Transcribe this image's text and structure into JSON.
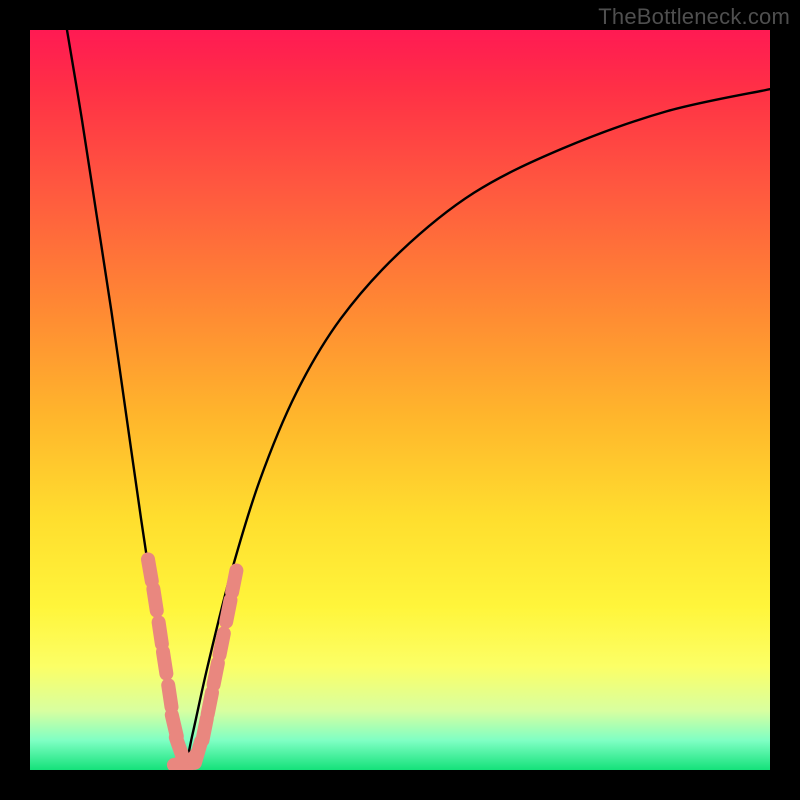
{
  "watermark": "TheBottleneck.com",
  "colors": {
    "frame": "#000000",
    "curve": "#000000",
    "marker": "#e9877f",
    "gradient_top": "#ff1a53",
    "gradient_bottom": "#14e27a"
  },
  "chart_data": {
    "type": "line",
    "title": "",
    "xlabel": "",
    "ylabel": "",
    "xlim": [
      0,
      100
    ],
    "ylim": [
      0,
      100
    ],
    "grid": false,
    "legend": false,
    "series": [
      {
        "name": "bottleneck-curve-left",
        "x": [
          5,
          7,
          9,
          11,
          13,
          15,
          16.5,
          18,
          19,
          20,
          20.8
        ],
        "values": [
          100,
          88,
          75,
          62,
          48,
          34,
          24,
          14,
          8,
          3,
          0
        ]
      },
      {
        "name": "bottleneck-curve-right",
        "x": [
          20.8,
          22,
          24,
          27,
          31,
          36,
          42,
          50,
          60,
          72,
          86,
          100
        ],
        "values": [
          0,
          5,
          14,
          26,
          39,
          51,
          61,
          70,
          78,
          84,
          89,
          92
        ]
      }
    ],
    "markers": {
      "name": "highlight-segments",
      "points": [
        {
          "x": 16.2,
          "y": 27
        },
        {
          "x": 16.9,
          "y": 23
        },
        {
          "x": 17.6,
          "y": 18.5
        },
        {
          "x": 18.2,
          "y": 14.5
        },
        {
          "x": 18.9,
          "y": 10
        },
        {
          "x": 19.5,
          "y": 6
        },
        {
          "x": 20.2,
          "y": 3
        },
        {
          "x": 20.9,
          "y": 1
        },
        {
          "x": 21.8,
          "y": 1.2
        },
        {
          "x": 22.7,
          "y": 2.4
        },
        {
          "x": 23.6,
          "y": 5.5
        },
        {
          "x": 24.3,
          "y": 9
        },
        {
          "x": 25.1,
          "y": 13
        },
        {
          "x": 25.9,
          "y": 17
        },
        {
          "x": 26.8,
          "y": 21.5
        },
        {
          "x": 27.6,
          "y": 25.5
        }
      ]
    }
  }
}
